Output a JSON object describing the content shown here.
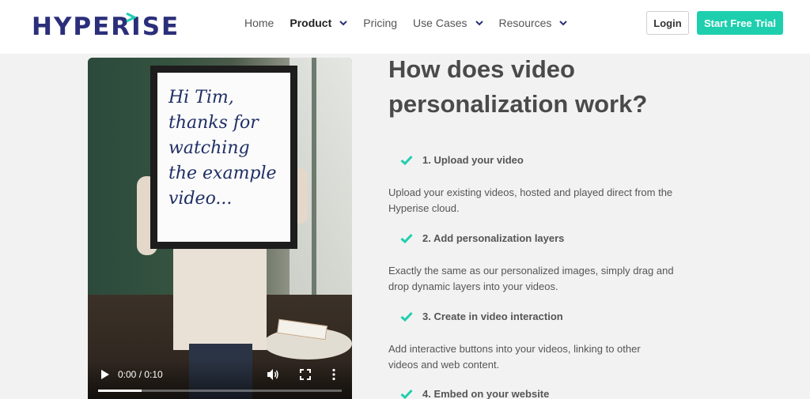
{
  "header": {
    "logo_text": "HYPERISE",
    "nav": [
      {
        "label": "Home",
        "active": false,
        "has_dropdown": false
      },
      {
        "label": "Product",
        "active": true,
        "has_dropdown": true
      },
      {
        "label": "Pricing",
        "active": false,
        "has_dropdown": false
      },
      {
        "label": "Use Cases",
        "active": false,
        "has_dropdown": true
      },
      {
        "label": "Resources",
        "active": false,
        "has_dropdown": true
      }
    ],
    "login_label": "Login",
    "trial_label": "Start Free Trial"
  },
  "video": {
    "board_lines": [
      "Hi Tim,",
      "thanks for",
      "watching",
      "the example",
      "video..."
    ],
    "time_display": "0:00 / 0:10",
    "progress": 0.18,
    "icons": [
      "play-icon",
      "volume-icon",
      "fullscreen-icon",
      "more-options-icon"
    ]
  },
  "content": {
    "heading_lines": [
      "How does video",
      "personalization work?"
    ],
    "steps": [
      {
        "title": "1. Upload your video",
        "desc": [
          "Upload your existing videos, hosted and played direct from the",
          "Hyperise cloud."
        ]
      },
      {
        "title": "2. Add personalization layers",
        "desc": [
          "Exactly the same as our personalized images, simply drag and",
          "drop dynamic layers into your videos."
        ]
      },
      {
        "title": "3. Create in video interaction",
        "desc": [
          "Add interactive buttons into your videos, linking to other",
          "videos and web content."
        ]
      },
      {
        "title": "4. Embed on your website",
        "desc": []
      }
    ]
  },
  "colors": {
    "accent": "#1ecfae",
    "logo": "#2b2f7a",
    "background": "#f2f2f2"
  }
}
